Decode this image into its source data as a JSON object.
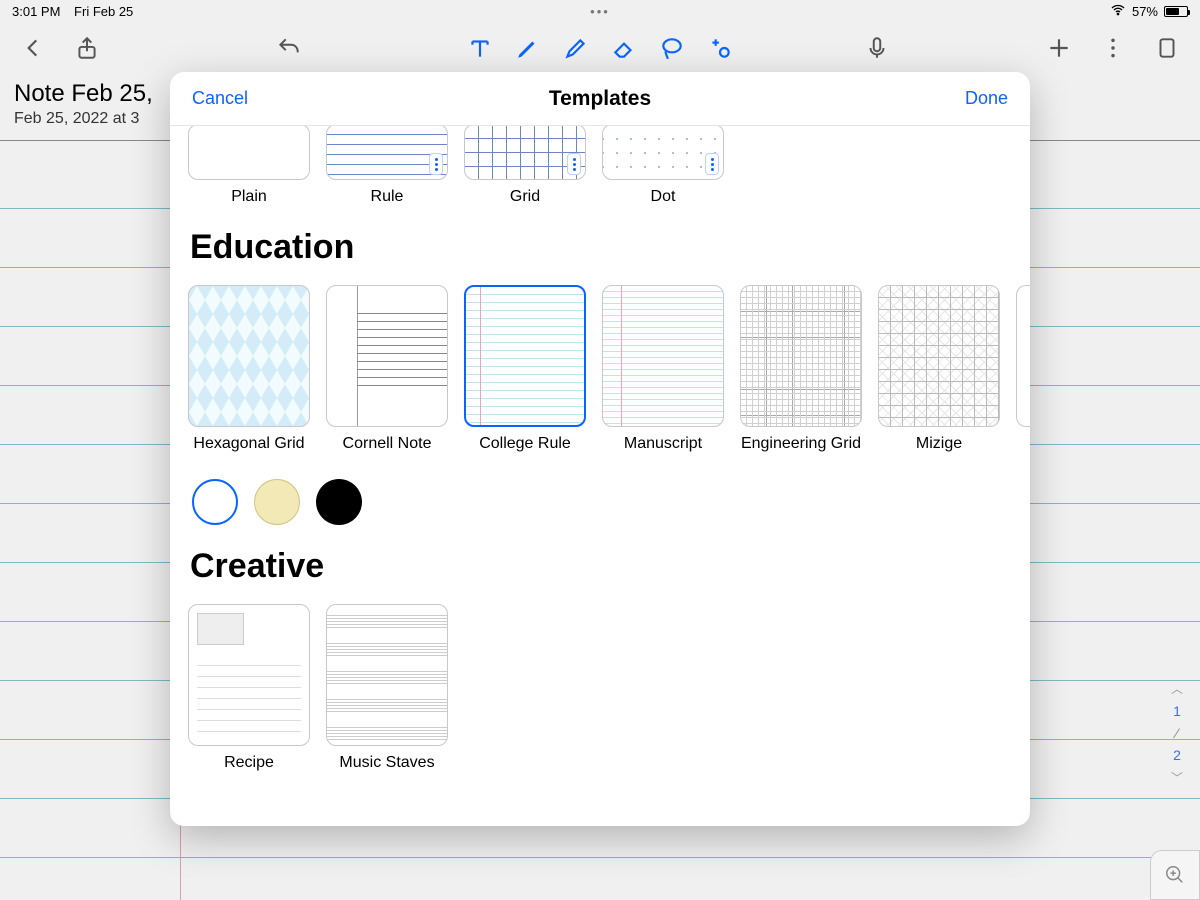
{
  "status": {
    "time": "3:01 PM",
    "date": "Fri Feb 25",
    "battery_pct": "57%"
  },
  "note": {
    "title": "Note Feb 25,",
    "subtitle": "Feb 25, 2022 at 3"
  },
  "pages": {
    "current": "1",
    "total": "2"
  },
  "modal": {
    "cancel": "Cancel",
    "title": "Templates",
    "done": "Done",
    "top_row": {
      "plain": "Plain",
      "rule": "Rule",
      "grid": "Grid",
      "dot": "Dot"
    },
    "sections": {
      "education": {
        "title": "Education",
        "items": {
          "hexagonal": "Hexagonal Grid",
          "cornell": "Cornell Note",
          "college": "College Rule",
          "manuscript": "Manuscript",
          "engineering": "Engineering Grid",
          "mizige": "Mizige"
        }
      },
      "creative": {
        "title": "Creative",
        "items": {
          "recipe": "Recipe",
          "staves": "Music Staves"
        }
      }
    }
  }
}
